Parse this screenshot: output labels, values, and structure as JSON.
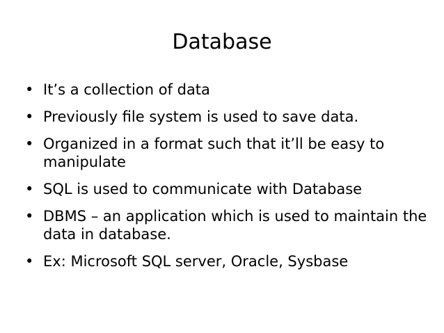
{
  "slide": {
    "title": "Database",
    "bullet_symbol": "•",
    "bullets": [
      "It’s a collection of data",
      "Previously file system is used to save data.",
      "Organized in a format such that it’ll be easy to manipulate",
      "SQL is used to communicate with Database",
      "DBMS – an application which is used to maintain the data in database.",
      "Ex: Microsoft SQL server, Oracle, Sysbase"
    ]
  }
}
